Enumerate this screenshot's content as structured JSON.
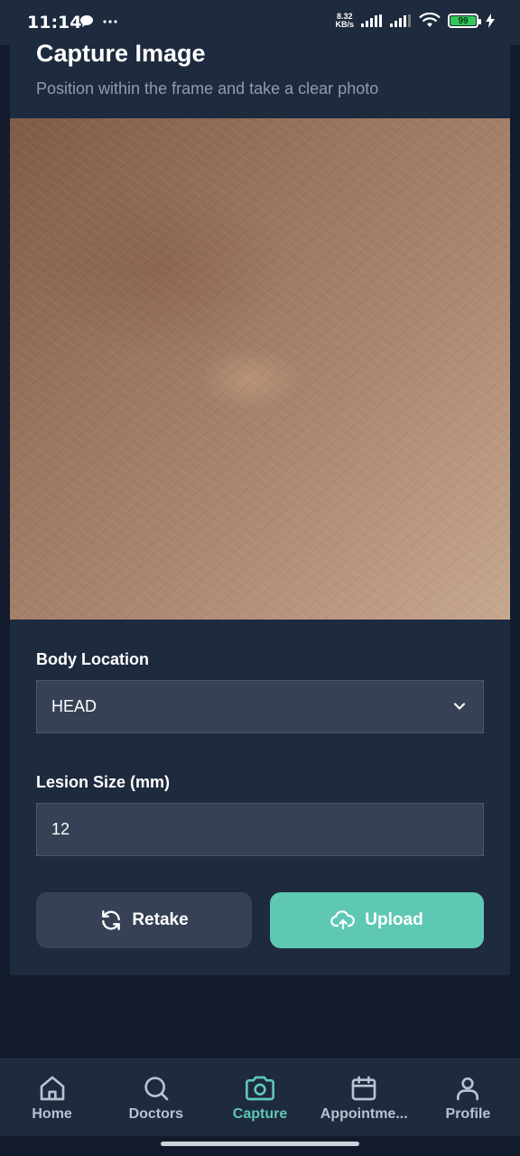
{
  "status_bar": {
    "time": "11:14",
    "network_speed_value": "8.32",
    "network_speed_unit": "KB/s",
    "battery_level": "99"
  },
  "header": {
    "title": "Capture Image",
    "subtitle": "Position within the frame and take a clear photo"
  },
  "form": {
    "body_location_label": "Body Location",
    "body_location_value": "HEAD",
    "lesion_size_label": "Lesion Size (mm)",
    "lesion_size_value": "12"
  },
  "actions": {
    "retake_label": "Retake",
    "upload_label": "Upload"
  },
  "nav": {
    "items": [
      {
        "label": "Home",
        "icon": "home-icon"
      },
      {
        "label": "Doctors",
        "icon": "search-icon"
      },
      {
        "label": "Capture",
        "icon": "camera-icon",
        "active": true
      },
      {
        "label": "Appointme...",
        "icon": "calendar-icon"
      },
      {
        "label": "Profile",
        "icon": "user-icon"
      }
    ]
  },
  "colors": {
    "accent": "#5ec8b5",
    "background": "#131a2b",
    "card": "#1e2a3d",
    "input": "#364155"
  }
}
